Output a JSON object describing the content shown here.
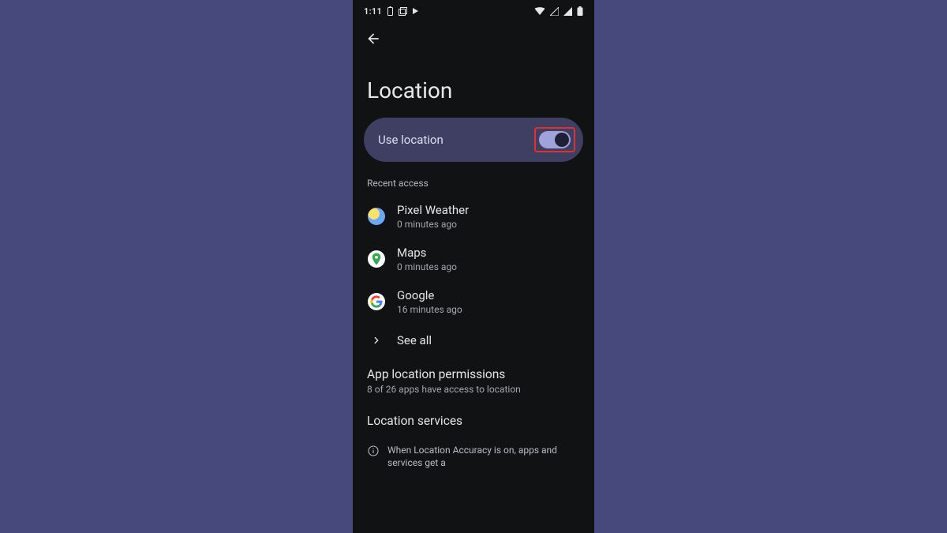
{
  "statusbar": {
    "time": "1:11"
  },
  "page": {
    "title": "Location"
  },
  "useLocation": {
    "label": "Use location",
    "on": true
  },
  "recent": {
    "heading": "Recent access",
    "items": [
      {
        "name": "Pixel Weather",
        "sub": "0 minutes ago"
      },
      {
        "name": "Maps",
        "sub": "0 minutes ago"
      },
      {
        "name": "Google",
        "sub": "16 minutes ago"
      }
    ],
    "seeAll": "See all"
  },
  "permissions": {
    "title": "App location permissions",
    "sub": "8 of 26 apps have access to location"
  },
  "services": {
    "title": "Location services"
  },
  "info": {
    "text": "When Location Accuracy is on, apps and services get a"
  }
}
